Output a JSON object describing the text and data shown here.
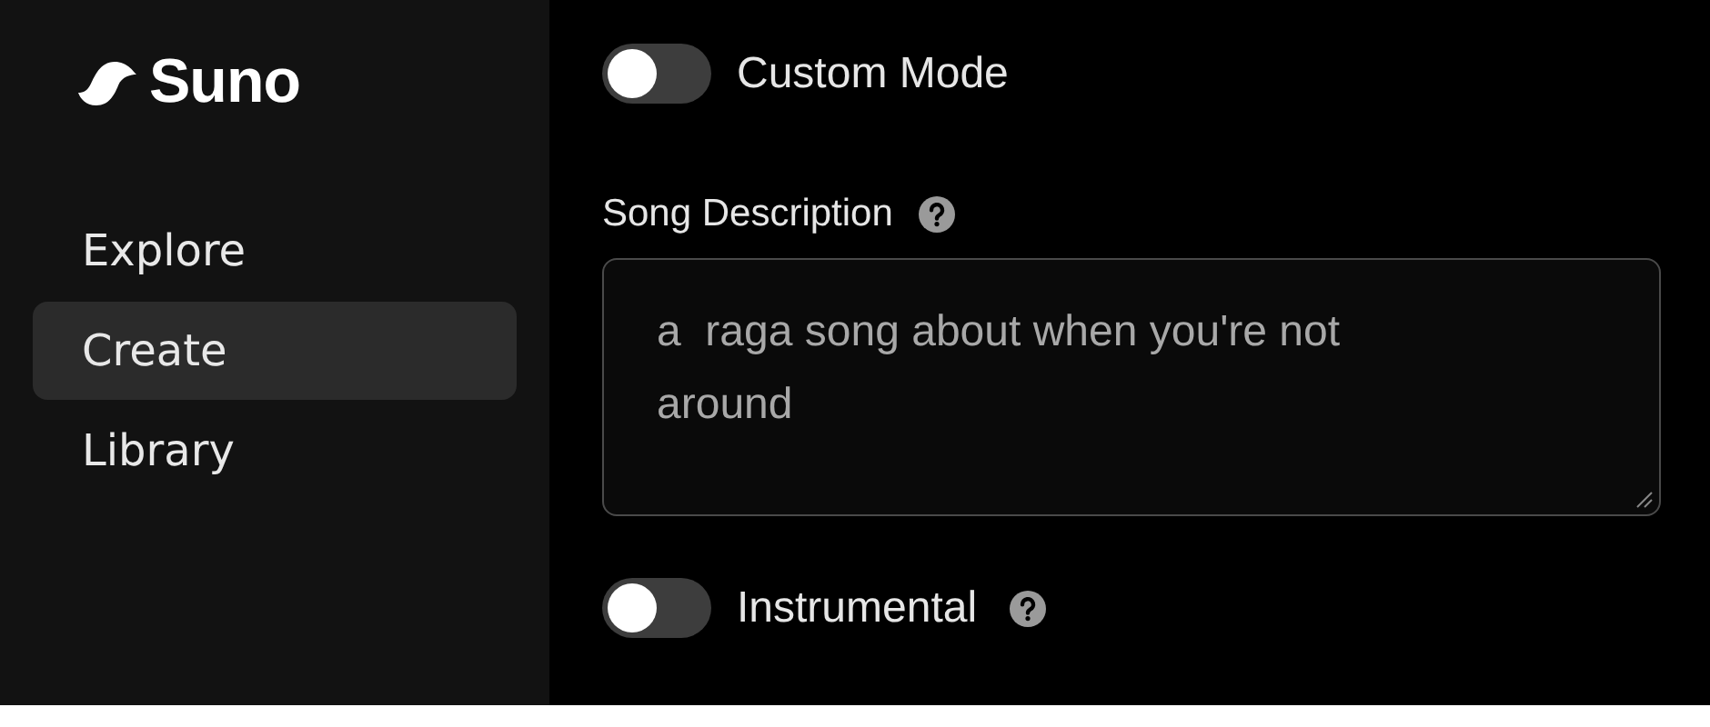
{
  "sidebar": {
    "logo": "Suno",
    "items": [
      {
        "label": "Explore",
        "selected": false
      },
      {
        "label": "Create",
        "selected": true
      },
      {
        "label": "Library",
        "selected": false
      }
    ]
  },
  "custom_mode": {
    "label": "Custom Mode",
    "on": false
  },
  "song_description": {
    "label": "Song Description",
    "value": "a  raga song about when you're not around"
  },
  "instrumental": {
    "label": "Instrumental",
    "on": false
  }
}
